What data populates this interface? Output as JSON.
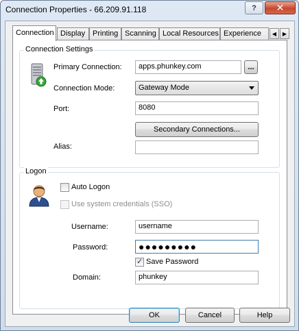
{
  "window": {
    "title": "Connection Properties - 66.209.91.118",
    "help_glyph": "?",
    "close_glyph": "✕"
  },
  "tabs": [
    {
      "label": "Connection",
      "active": true
    },
    {
      "label": "Display"
    },
    {
      "label": "Printing"
    },
    {
      "label": "Scanning"
    },
    {
      "label": "Local Resources"
    },
    {
      "label": "Experience"
    }
  ],
  "tab_scroll": {
    "left": "◀",
    "right": "▶"
  },
  "connection_settings": {
    "title": "Connection Settings",
    "primary_connection_label": "Primary Connection:",
    "primary_connection_value": "apps.phunkey.com",
    "browse_label": "...",
    "connection_mode_label": "Connection Mode:",
    "connection_mode_value": "Gateway Mode",
    "port_label": "Port:",
    "port_value": "8080",
    "secondary_button": "Secondary Connections...",
    "alias_label": "Alias:",
    "alias_value": ""
  },
  "logon": {
    "title": "Logon",
    "auto_logon_label": "Auto Logon",
    "auto_logon_checked": false,
    "sso_label": "Use system credentials (SSO)",
    "sso_checked": false,
    "username_label": "Username:",
    "username_value": "username",
    "password_label": "Password:",
    "password_value": "●●●●●●●●●",
    "save_password_label": "Save Password",
    "save_password_checked": true,
    "check_glyph": "✓",
    "domain_label": "Domain:",
    "domain_value": "phunkey"
  },
  "footer": {
    "ok": "OK",
    "cancel": "Cancel",
    "help": "Help"
  }
}
